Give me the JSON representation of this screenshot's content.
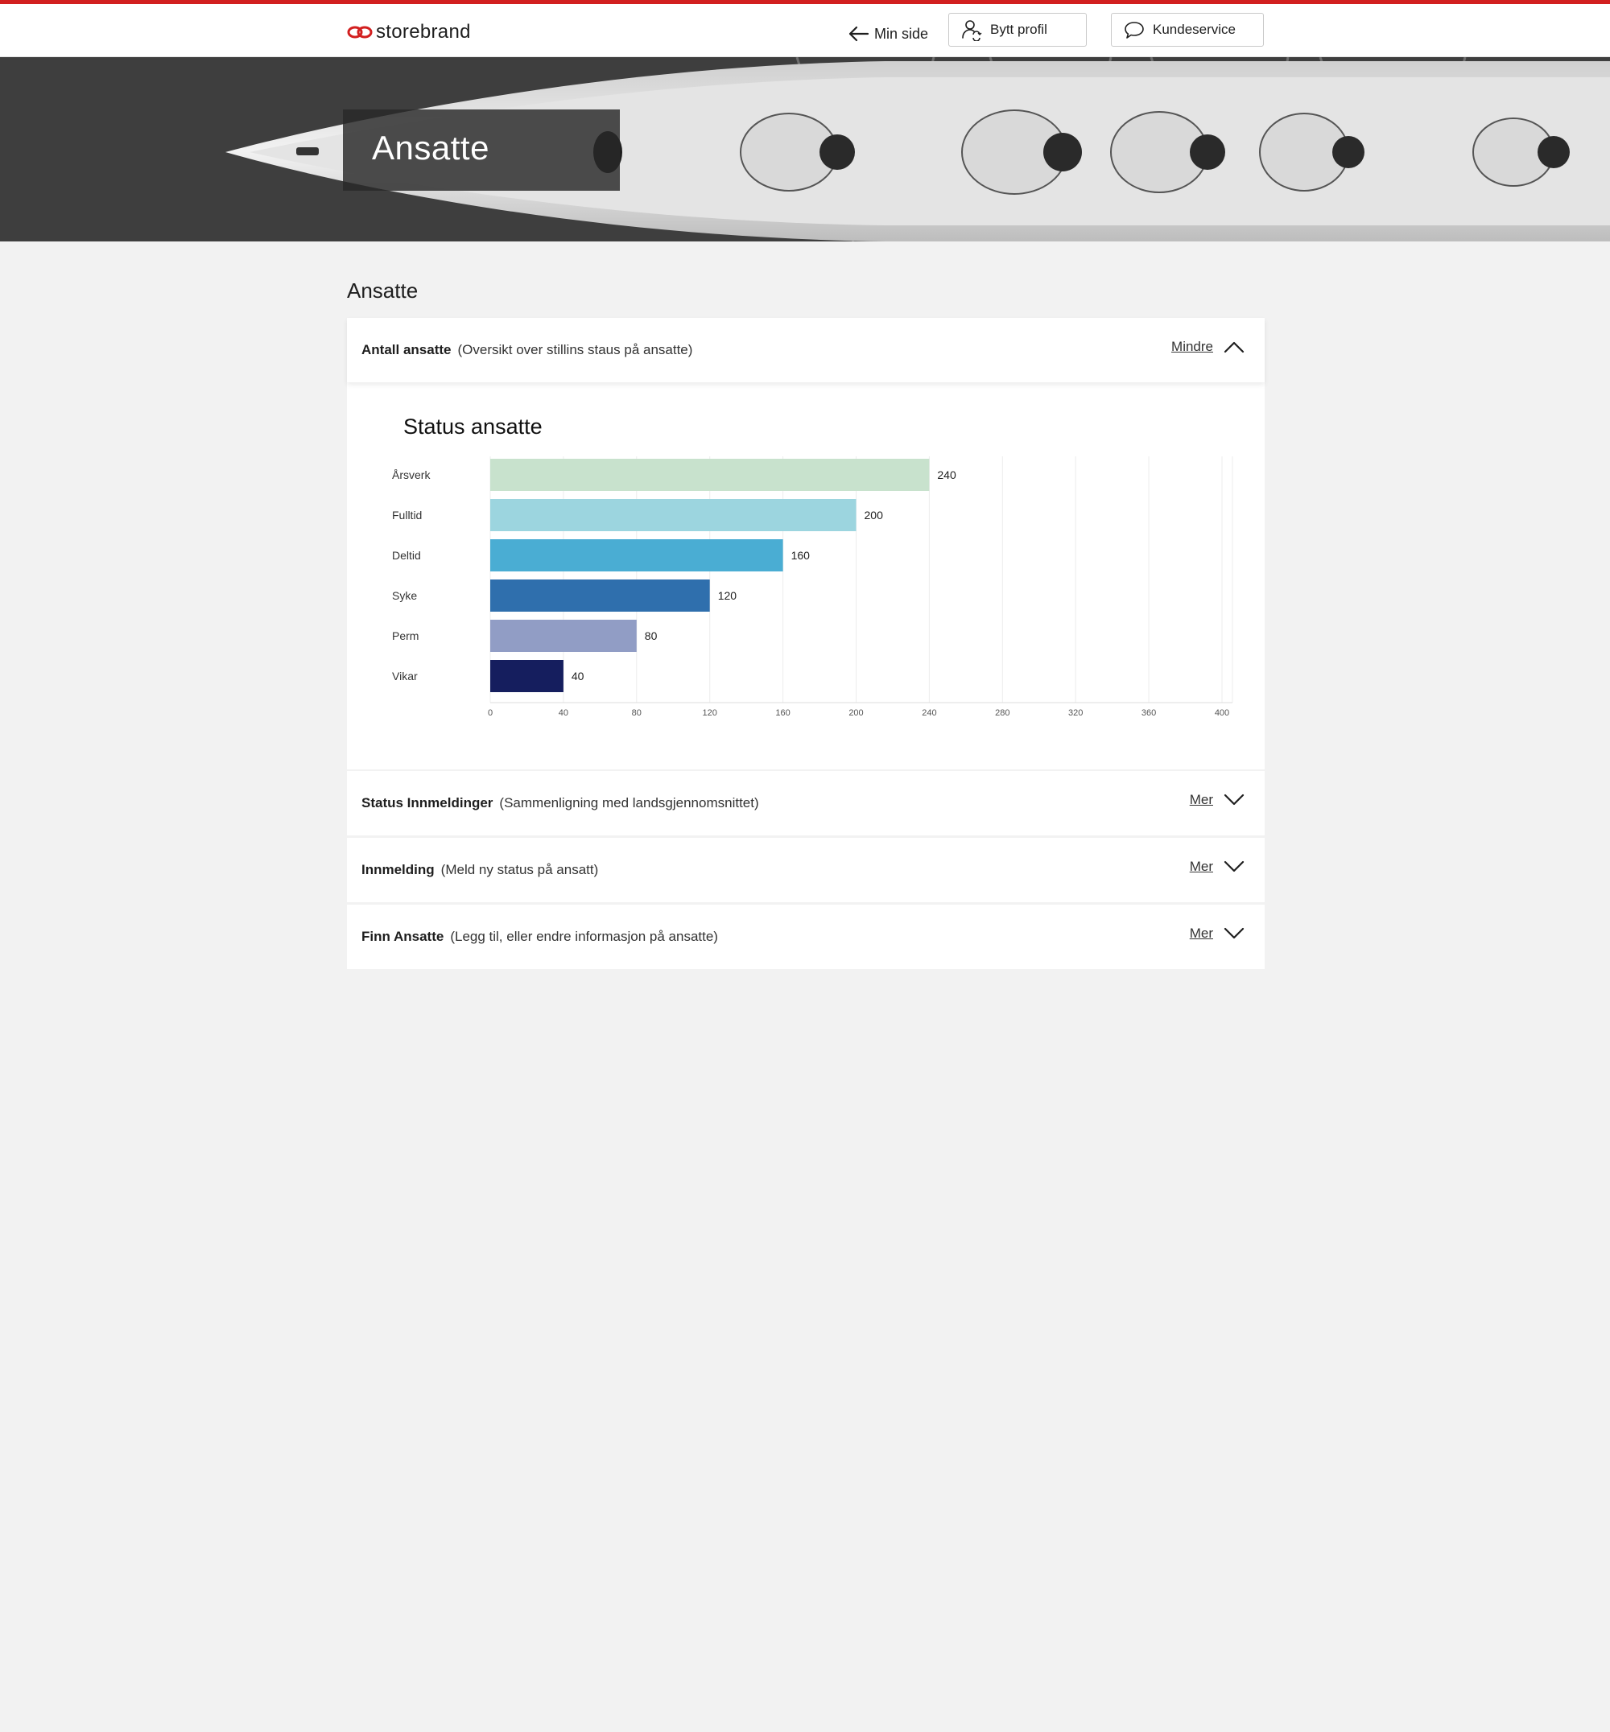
{
  "header": {
    "logo_text": "storebrand",
    "back_label": "Min side",
    "profile_label": "Bytt profil",
    "service_label": "Kundeservice"
  },
  "hero": {
    "title": "Ansatte"
  },
  "section_title": "Ansatte",
  "accordions": [
    {
      "title": "Antall ansatte",
      "description": "(Oversikt over stillins staus på ansatte)",
      "toggle": "Mindre",
      "expanded": true
    },
    {
      "title": "Status Innmeldinger",
      "description": "(Sammenligning med landsgjennomsnittet)",
      "toggle": "Mer",
      "expanded": false
    },
    {
      "title": "Innmelding",
      "description": "(Meld ny status på ansatt)",
      "toggle": "Mer",
      "expanded": false
    },
    {
      "title": "Finn Ansatte",
      "description": "(Legg til, eller endre informasjon på ansatte)",
      "toggle": "Mer",
      "expanded": false
    }
  ],
  "chart_data": {
    "type": "bar",
    "orientation": "horizontal",
    "title": "Status ansatte",
    "categories": [
      "Årsverk",
      "Fulltid",
      "Deltid",
      "Syke",
      "Perm",
      "Vikar"
    ],
    "values": [
      240,
      200,
      160,
      120,
      80,
      40
    ],
    "colors": [
      "#c8e2cd",
      "#9cd5df",
      "#4aadd3",
      "#2f6fad",
      "#919dc5",
      "#151e5e"
    ],
    "x_ticks": [
      0,
      40,
      80,
      120,
      160,
      200,
      240,
      280,
      320,
      360,
      400
    ],
    "xlim": [
      0,
      440
    ],
    "grid": true,
    "data_labels": true
  },
  "colors": {
    "brand_red": "#d21f1f",
    "page_bg": "#f2f2f2"
  },
  "icons": {
    "back": "arrow-left-icon",
    "profile": "switch-profile-icon",
    "service": "chat-bubble-icon",
    "collapse": "chevron-up-icon",
    "expand": "chevron-down-icon"
  }
}
